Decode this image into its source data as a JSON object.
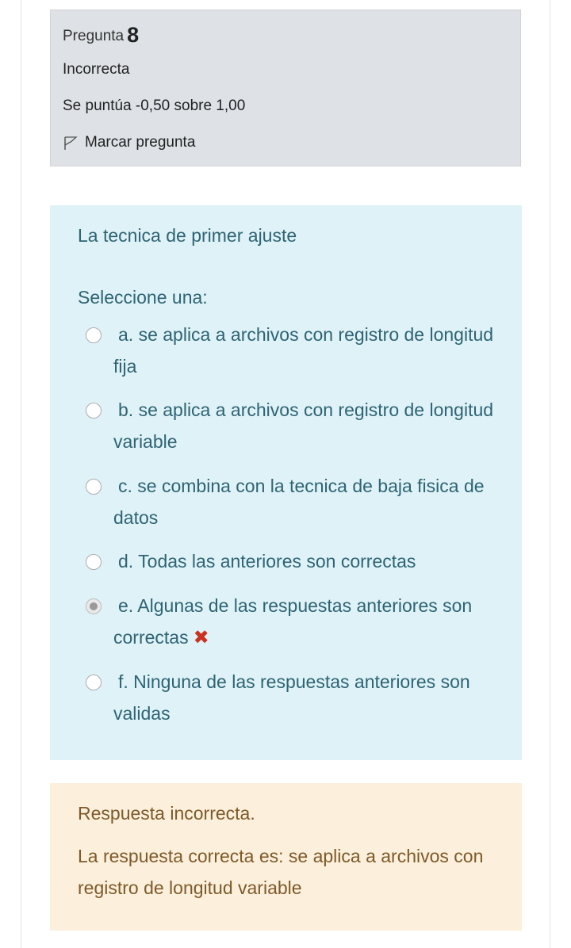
{
  "question_info": {
    "label": "Pregunta",
    "number": "8",
    "state": "Incorrecta",
    "grade": "Se puntúa -0,50 sobre 1,00",
    "flag_label": "Marcar pregunta"
  },
  "question": {
    "text": "La tecnica de primer ajuste",
    "prompt": "Seleccione una:",
    "options": [
      {
        "label": "a. se aplica a archivos con registro de longitud fija",
        "selected": false
      },
      {
        "label": "b. se aplica a archivos con registro de longitud variable",
        "selected": false
      },
      {
        "label": "c. se combina con la tecnica de baja fisica de datos",
        "selected": false
      },
      {
        "label": "d. Todas las anteriores son correctas",
        "selected": false
      },
      {
        "label": "e. Algunas de las respuestas anteriores son correctas",
        "selected": true,
        "marked": "incorrect"
      },
      {
        "label": "f. Ninguna de las respuestas anteriores son validas",
        "selected": false
      }
    ]
  },
  "feedback": {
    "result": "Respuesta incorrecta.",
    "correct_answer": "La respuesta correcta es: se aplica a archivos con registro de longitud variable"
  },
  "colors": {
    "info_background": "#dee2e6",
    "content_background": "#def2f8",
    "content_text": "#2f6473",
    "feedback_background": "#fcefdc",
    "feedback_text": "#7d5a29",
    "incorrect_icon": "#ca3120"
  },
  "icons": {
    "flag": "flag-outline-icon",
    "incorrect": "cross-icon"
  }
}
